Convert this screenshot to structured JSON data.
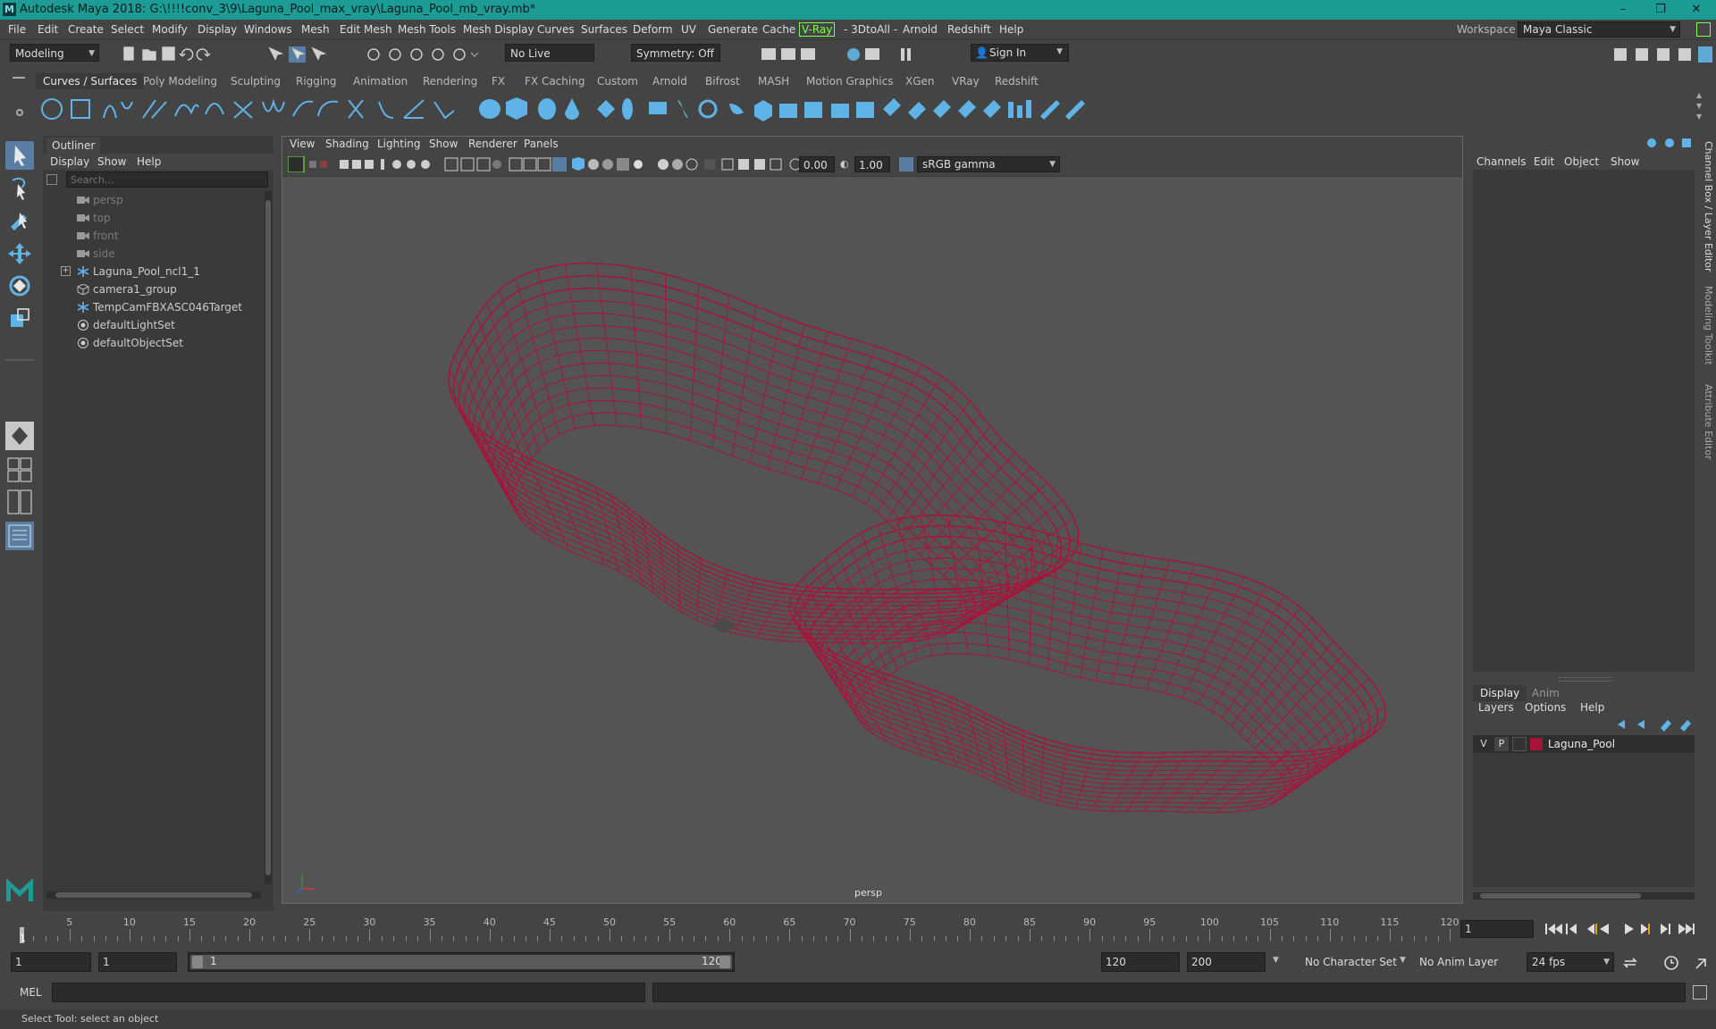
{
  "app": {
    "title": "Autodesk Maya 2018: G:\\!!!!conv_3\\9\\Laguna_Pool_max_vray\\Laguna_Pool_mb_vray.mb*",
    "logo": "M",
    "window_controls": [
      "–",
      "❐",
      "✕"
    ]
  },
  "menu": {
    "items": [
      "File",
      "Edit",
      "Create",
      "Select",
      "Modify",
      "Display",
      "Windows",
      "Mesh",
      "Edit Mesh",
      "Mesh Tools",
      "Mesh Display",
      "Curves",
      "Surfaces",
      "Deform",
      "UV",
      "Generate",
      "Cache",
      "V-Ray",
      "- 3DtoAll -",
      "Arnold",
      "Redshift",
      "Help"
    ],
    "workspace_label": "Workspace :",
    "workspace_value": "Maya Classic"
  },
  "status_line": {
    "mode": "Modeling",
    "live_surface": "No Live Surface",
    "symmetry": "Symmetry: Off",
    "sign_in": "Sign In"
  },
  "shelf": {
    "tabs": [
      "Curves / Surfaces",
      "Poly Modeling",
      "Sculpting",
      "Rigging",
      "Animation",
      "Rendering",
      "FX",
      "FX Caching",
      "Custom",
      "Arnold",
      "Bifrost",
      "MASH",
      "Motion Graphics",
      "XGen",
      "VRay",
      "Redshift"
    ],
    "active_tab": "Curves / Surfaces"
  },
  "outliner": {
    "title": "Outliner",
    "menu": [
      "Display",
      "Show",
      "Help"
    ],
    "search_placeholder": "Search...",
    "items": [
      {
        "label": "persp",
        "icon": "camera-icon",
        "dim": true
      },
      {
        "label": "top",
        "icon": "camera-icon",
        "dim": true
      },
      {
        "label": "front",
        "icon": "camera-icon",
        "dim": true
      },
      {
        "label": "side",
        "icon": "camera-icon",
        "dim": true
      },
      {
        "label": "Laguna_Pool_ncl1_1",
        "icon": "joint-icon",
        "dim": false,
        "expandable": true
      },
      {
        "label": "camera1_group",
        "icon": "group-icon",
        "dim": false
      },
      {
        "label": "TempCamFBXASC046Target",
        "icon": "joint-icon",
        "dim": false
      },
      {
        "label": "defaultLightSet",
        "icon": "set-icon",
        "dim": false
      },
      {
        "label": "defaultObjectSet",
        "icon": "set-icon",
        "dim": false
      }
    ]
  },
  "viewport": {
    "menu": [
      "View",
      "Shading",
      "Lighting",
      "Show",
      "Renderer",
      "Panels"
    ],
    "exposure": "0.00",
    "gamma": "1.00",
    "color_space": "sRGB gamma",
    "camera_label": "persp",
    "wire_color": "#a8133a"
  },
  "channel_box": {
    "menu": [
      "Channels",
      "Edit",
      "Object",
      "Show"
    ],
    "side_tabs": [
      "Channel Box / Layer Editor",
      "Modeling Toolkit",
      "Attribute Editor"
    ]
  },
  "layer_editor": {
    "tabs": [
      "Display",
      "Anim"
    ],
    "active_tab": "Display",
    "menu": [
      "Layers",
      "Options",
      "Help"
    ],
    "layers": [
      {
        "visible": "V",
        "playback": "P",
        "name": "Laguna_Pool",
        "color": "#a8133a"
      }
    ]
  },
  "time_slider": {
    "start": 1,
    "end": 120,
    "major_ticks": [
      5,
      10,
      15,
      20,
      25,
      30,
      35,
      40,
      45,
      50,
      55,
      60,
      65,
      70,
      75,
      80,
      85,
      90,
      95,
      100,
      105,
      110,
      115,
      120
    ],
    "current_frame": "1"
  },
  "range_slider": {
    "start_time": "1",
    "playback_start": "1",
    "range_start": "1",
    "range_end": "120",
    "playback_end": "120",
    "end_time": "200",
    "character_set": "No Character Set",
    "anim_layer": "No Anim Layer",
    "fps": "24 fps"
  },
  "command_line": {
    "label": "MEL"
  },
  "help_line": {
    "text": "Select Tool: select an object"
  }
}
